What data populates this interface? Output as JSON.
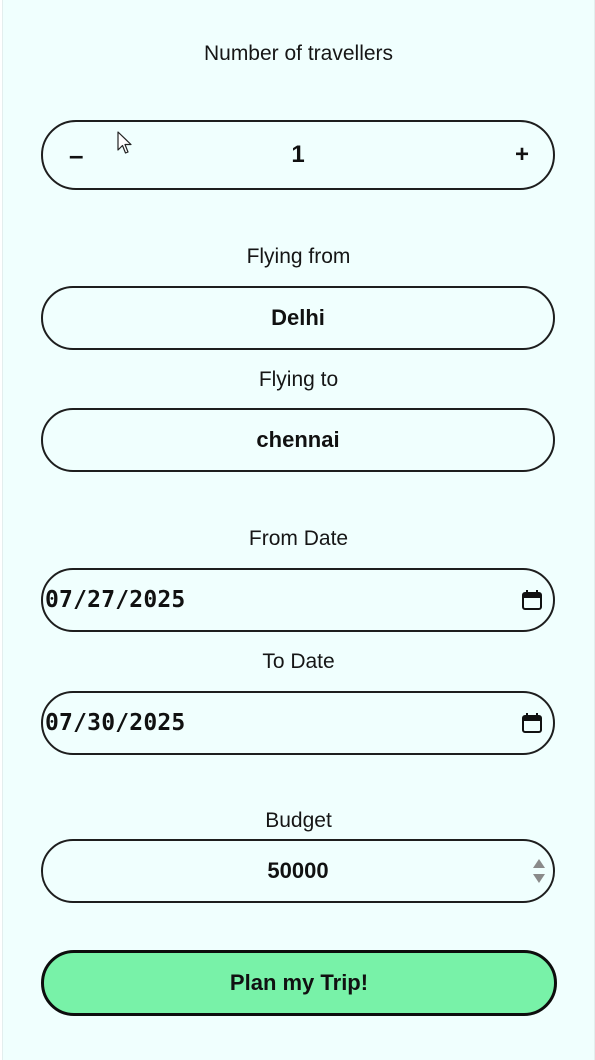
{
  "travellers": {
    "label": "Number of travellers",
    "value": "1",
    "minus_symbol": "–",
    "plus_symbol": "+"
  },
  "flying_from": {
    "label": "Flying from",
    "value": "Delhi"
  },
  "flying_to": {
    "label": "Flying to",
    "value": "chennai"
  },
  "from_date": {
    "label": "From Date",
    "value": "07/27/2025",
    "icon": "calendar-icon"
  },
  "to_date": {
    "label": "To Date",
    "value": "07/30/2025",
    "icon": "calendar-icon"
  },
  "budget": {
    "label": "Budget",
    "value": "50000",
    "icon": "spinner-arrows-icon"
  },
  "submit": {
    "label": "Plan my Trip!"
  },
  "colors": {
    "background": "#f0fffe",
    "border": "#1e1e1e",
    "button_fill": "#78f2a8"
  }
}
